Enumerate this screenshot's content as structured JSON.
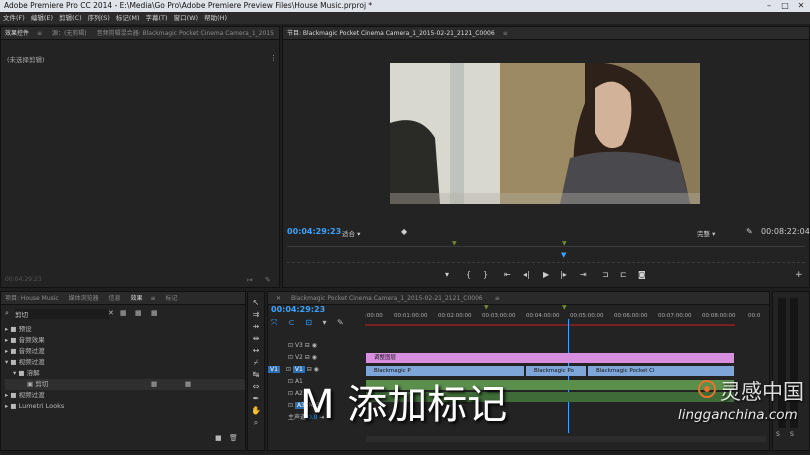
{
  "window": {
    "title": "Adobe Premiere Pro CC 2014 - E:\\Media\\Go Pro\\Adobe Premiere Preview Files\\House Music.prproj *"
  },
  "menu": [
    "文件(F)",
    "编辑(E)",
    "剪辑(C)",
    "序列(S)",
    "标记(M)",
    "字幕(T)",
    "窗口(W)",
    "帮助(H)"
  ],
  "source_panel": {
    "tabs": [
      "效果控件",
      "源：(无剪辑)",
      "音频剪辑混合器: Blackmagic Pocket Cinema Camera_1_2015"
    ],
    "empty_text": "(未选择剪辑)",
    "timecode": "00:04:29:23"
  },
  "program_panel": {
    "tab": "节目: Blackmagic Pocket Cinema Camera_1_2015-02-21_2121_C0006",
    "timecode": "00:04:29:23",
    "fit": "适合",
    "quality": "完整",
    "duration": "00:08:22:04"
  },
  "project_panel": {
    "tabs": [
      "项目: House Music",
      "媒体浏览器",
      "信息",
      "效果",
      "标记"
    ],
    "search_value": "剪切",
    "tree": [
      {
        "label": "预设",
        "level": 0
      },
      {
        "label": "音频效果",
        "level": 0
      },
      {
        "label": "音频过渡",
        "level": 0
      },
      {
        "label": "视频过渡",
        "level": 0
      },
      {
        "label": "溶解",
        "level": 1
      },
      {
        "label": "剪切",
        "level": 2
      },
      {
        "label": "视频过渡",
        "level": 0
      },
      {
        "label": "Lumetri Looks",
        "level": 0
      }
    ]
  },
  "timeline": {
    "tab": "Blackmagic Pocket Cinema Camera_1_2015-02-21_2121_C0006",
    "timecode": "00:04:29:23",
    "ruler": [
      ":00:00",
      "00:01:00:00",
      "00:02:00:00",
      "00:03:00:00",
      "00:04:00:00",
      "00:05:00:00",
      "00:06:00:00",
      "00:07:00:00",
      "00:08:00:00",
      "00:0"
    ],
    "tracks": [
      "V3",
      "V2",
      "V1",
      "A1",
      "A2",
      "A3"
    ],
    "master": {
      "label": "主声道",
      "value": "0.0"
    },
    "clips": {
      "v2": "调整图层",
      "v1": [
        "Blackmagic P",
        "Blackmagic Pocket Cinema",
        "Blackmagic Po",
        "Blackmagic Pocket Ci"
      ]
    },
    "playhead_frac": 0.55
  },
  "overlay": {
    "caption": "M 添加标记",
    "watermark_logo": "灵感中国",
    "watermark_url": "lingganchina.com"
  },
  "colors": {
    "accent": "#3aa3ff",
    "adjustment_clip": "#d98fe0",
    "video_clip": "#7ea6d8",
    "audio_clip": "#5b8f4c"
  }
}
